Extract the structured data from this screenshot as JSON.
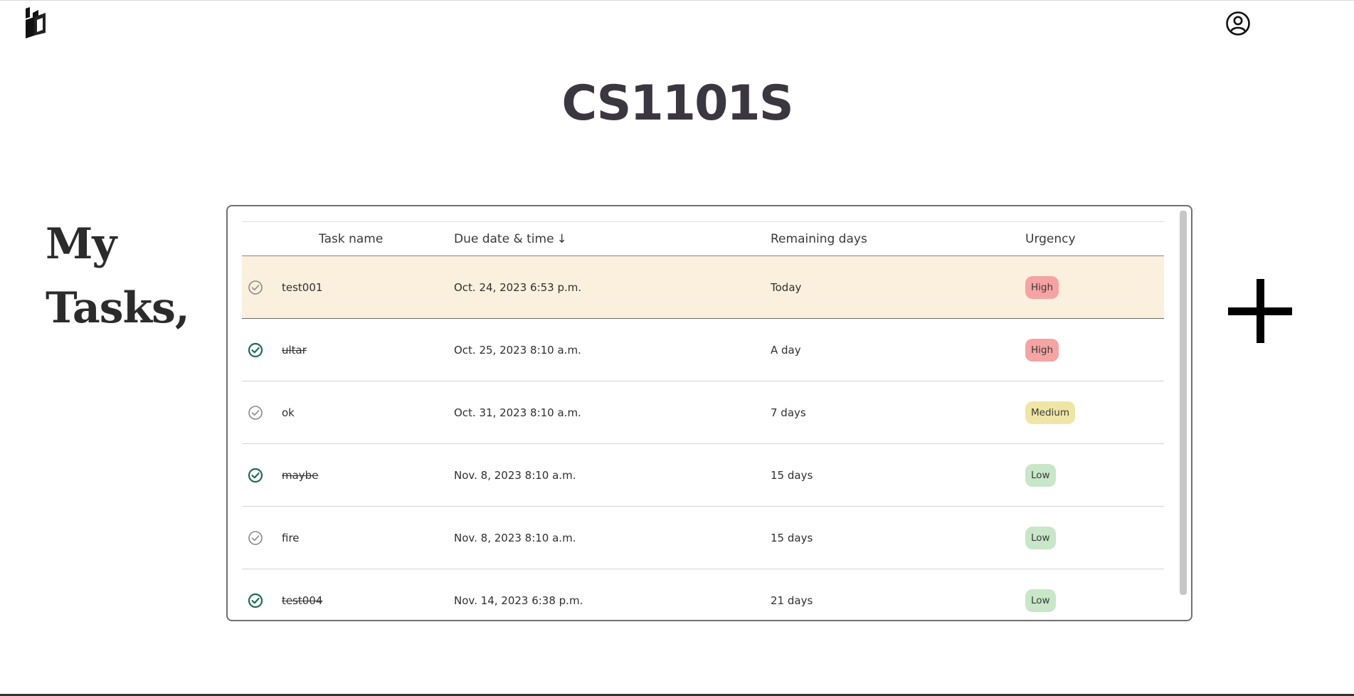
{
  "header": {
    "logo_icon": "brand-logo-icon",
    "profile_icon": "user-circle-icon"
  },
  "page": {
    "course_title": "CS1101S",
    "heading_line1": "My",
    "heading_line2": "Tasks,"
  },
  "table": {
    "columns": {
      "name": "Task name",
      "due": "Due date & time",
      "due_sort_icon": "↓",
      "remaining": "Remaining days",
      "urgency": "Urgency"
    },
    "rows": [
      {
        "name": "test001",
        "due": "Oct. 24, 2023 6:53 p.m.",
        "remaining": "Today",
        "urgency": "High",
        "done": false,
        "highlight": true
      },
      {
        "name": "ultar",
        "due": "Oct. 25, 2023 8:10 a.m.",
        "remaining": "A day",
        "urgency": "High",
        "done": true,
        "highlight": false
      },
      {
        "name": "ok",
        "due": "Oct. 31, 2023 8:10 a.m.",
        "remaining": "7 days",
        "urgency": "Medium",
        "done": false,
        "highlight": false
      },
      {
        "name": "maybe",
        "due": "Nov. 8, 2023 8:10 a.m.",
        "remaining": "15 days",
        "urgency": "Low",
        "done": true,
        "highlight": false
      },
      {
        "name": "fire",
        "due": "Nov. 8, 2023 8:10 a.m.",
        "remaining": "15 days",
        "urgency": "Low",
        "done": false,
        "highlight": false
      },
      {
        "name": "test004",
        "due": "Nov. 14, 2023 6:38 p.m.",
        "remaining": "21 days",
        "urgency": "Low",
        "done": true,
        "highlight": false
      }
    ]
  },
  "colors": {
    "highlight_row": "#fbf0dd",
    "urgency_high": "#f5a3a3",
    "urgency_medium": "#efe6a6",
    "urgency_low": "#c8e6c8",
    "check_done": "#1d6b57",
    "check_pending": "#8a8a8a"
  },
  "actions": {
    "add_icon": "plus-icon"
  }
}
